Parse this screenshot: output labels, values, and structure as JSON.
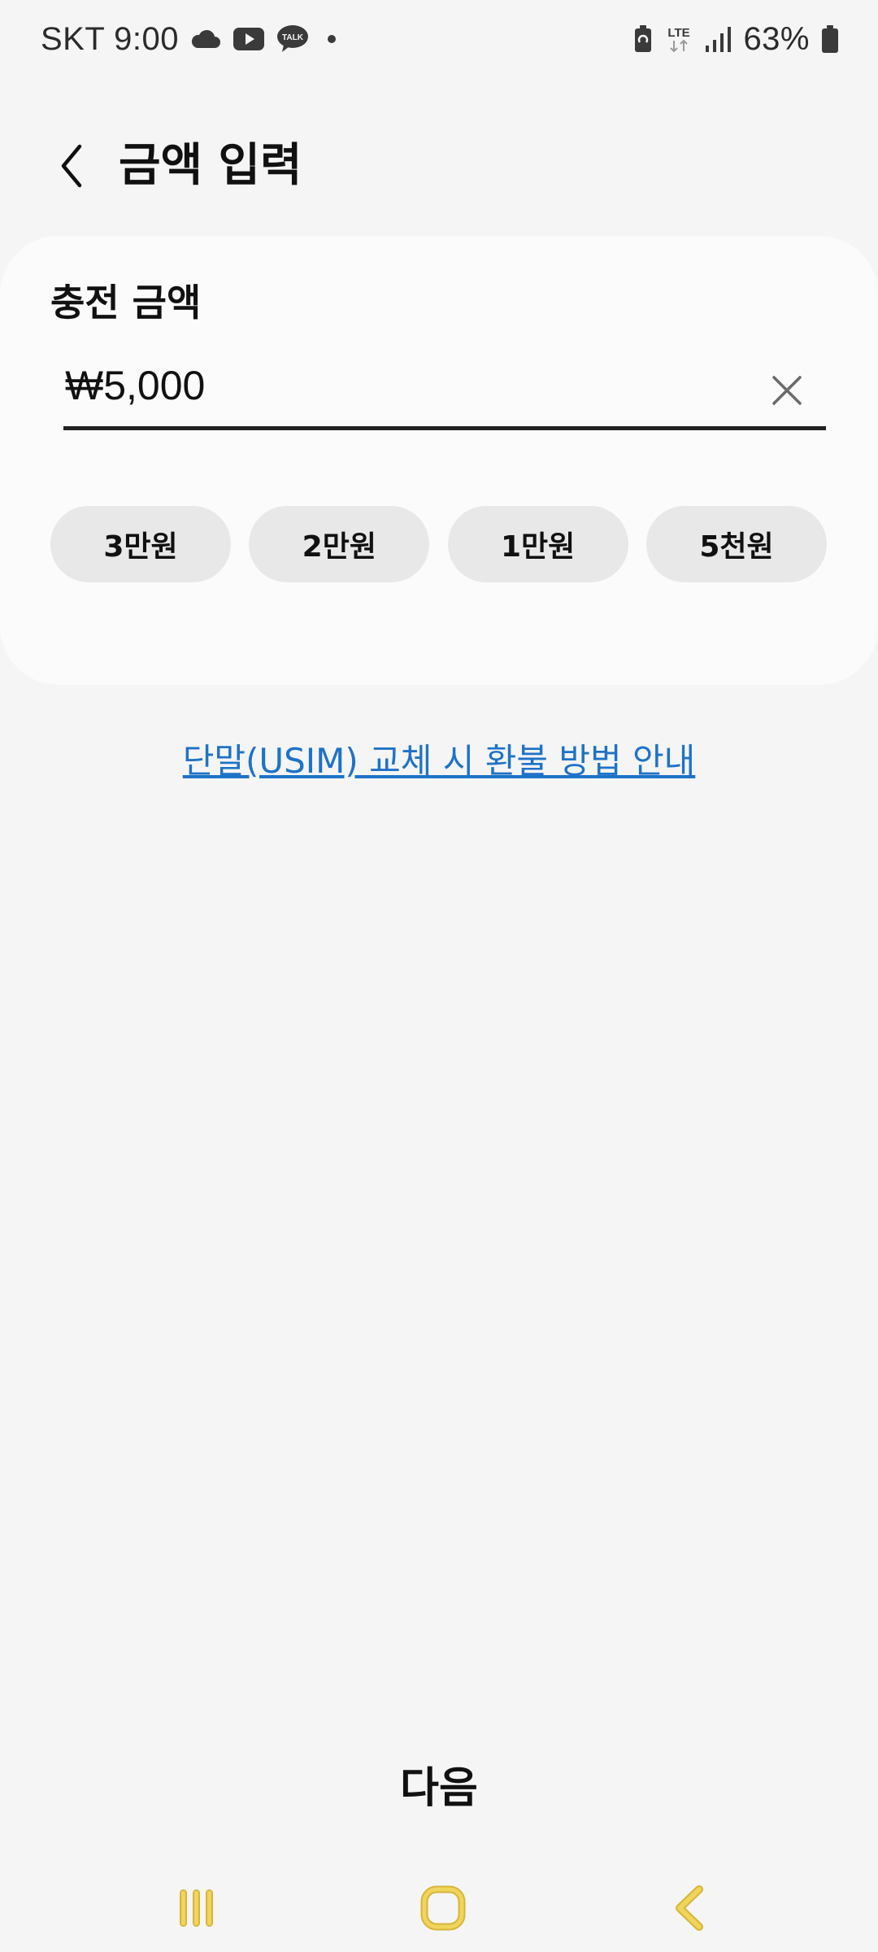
{
  "status_bar": {
    "carrier_time": "SKT 9:00",
    "network": "LTE",
    "battery": "63%",
    "icons": [
      "cloud-icon",
      "youtube-icon",
      "kakaotalk-icon",
      "dot-icon",
      "battery-saver-icon",
      "lte-icon",
      "signal-icon",
      "battery-icon"
    ],
    "talk_label": "TALK"
  },
  "header": {
    "title": "금액 입력"
  },
  "card": {
    "label": "충전 금액",
    "amount_value": "₩5,000",
    "chips": [
      {
        "label": "3만원"
      },
      {
        "label": "2만원"
      },
      {
        "label": "1만원"
      },
      {
        "label": "5천원"
      }
    ]
  },
  "refund_link": "단말(USIM) 교체 시 환불 방법 안내",
  "next_label": "다음",
  "colors": {
    "background": "#f5f5f5",
    "card": "#fbfbfb",
    "chip": "#e8e8e8",
    "link": "#1e73c8",
    "nav_icon": "#e8c84a"
  }
}
